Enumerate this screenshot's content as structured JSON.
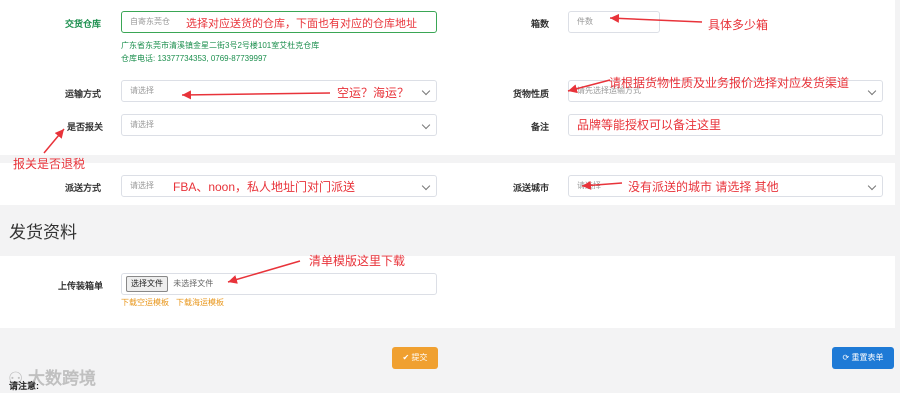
{
  "form": {
    "warehouse": {
      "label": "交货仓库",
      "value": "自寄东莞仓",
      "annotation": "选择对应送货的仓库，下面也有对应的仓库地址",
      "address": "广东省东莞市清溪镇金星二街3号2号楼101室艾杜克仓库",
      "phone": "仓库电话: 13377734353, 0769-87739997"
    },
    "boxes": {
      "label": "箱数",
      "placeholder": "件数",
      "annotation": "具体多少箱"
    },
    "transport": {
      "label": "运输方式",
      "placeholder": "请选择",
      "annotation": "空运？海运？"
    },
    "cargo_type": {
      "label": "货物性质",
      "placeholder": "请先选择运输方式",
      "annotation": "请根据货物性质及业务报价选择对应发货渠道"
    },
    "customs": {
      "label": "是否报关",
      "placeholder": "请选择",
      "annotation": "报关是否退税"
    },
    "remark": {
      "label": "备注",
      "value": "品牌等能授权可以备注这里"
    },
    "delivery_method": {
      "label": "派送方式",
      "placeholder": "请选择",
      "annotation": "FBA、noon，私人地址门对门派送"
    },
    "delivery_city": {
      "label": "派送城市",
      "placeholder": "请选择",
      "annotation": "没有派送的城市 请选择  其他"
    }
  },
  "shipping": {
    "section_title": "发货资料",
    "upload_label": "上传装箱单",
    "choose_file": "选择文件",
    "no_file": "未选择文件",
    "annotation": "清单模版这里下载",
    "link_air": "下载空运模板",
    "link_sea": "下载海运模板"
  },
  "actions": {
    "submit": "提交",
    "reset": "重置表单"
  },
  "footer": {
    "notice": "请注意:",
    "watermark": "大数跨境"
  },
  "colors": {
    "annotation": "#e8333a",
    "submit": "#f0a030",
    "reset": "#1e7ad6"
  }
}
